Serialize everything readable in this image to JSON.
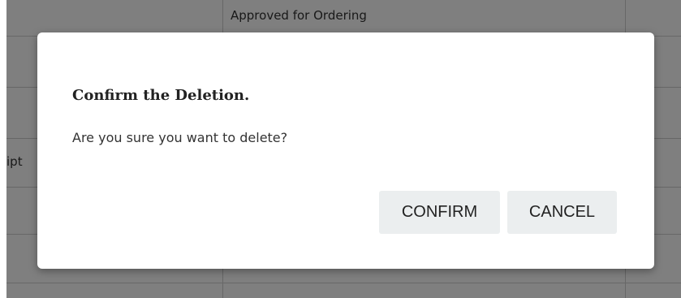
{
  "background_table": {
    "cells": [
      {
        "text": "Approved for Ordering"
      },
      {
        "text": "ipt"
      }
    ]
  },
  "dialog": {
    "title": "Confirm the Deletion.",
    "message": "Are you sure you want to delete?",
    "confirm_label": "CONFIRM",
    "cancel_label": "CANCEL"
  }
}
